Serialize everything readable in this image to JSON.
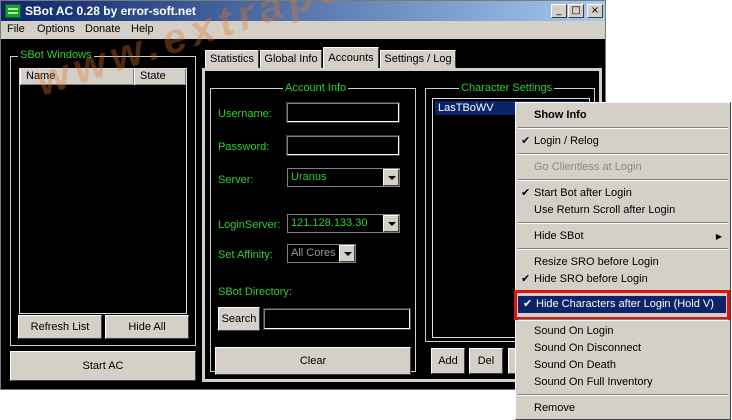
{
  "window": {
    "title": "SBot AC 0.28 by error-soft.net"
  },
  "titlebar_buttons": {
    "minimize": "_",
    "maximize": "□",
    "close": "×"
  },
  "menu": [
    "File",
    "Options",
    "Donate",
    "Help"
  ],
  "sbot_windows": {
    "label": "SBot Windows",
    "columns": [
      "Name",
      "State"
    ],
    "refresh_label": "Refresh List",
    "hide_all_label": "Hide All"
  },
  "start_label": "Start AC",
  "tabs": [
    "Statistics",
    "Global Info",
    "Accounts",
    "Settings / Log"
  ],
  "account_info": {
    "label": "Account Info",
    "username_label": "Username:",
    "password_label": "Password:",
    "server_label": "Server:",
    "server_value": "Uranus",
    "login_server_label": "LoginServer:",
    "login_server_value": "121.128.133.30",
    "affinity_label": "Set Affinity:",
    "affinity_value": "All Cores",
    "directory_label": "SBot Directory:",
    "search_label": "Search",
    "clear_label": "Clear"
  },
  "character_settings": {
    "label": "Character Settings",
    "character": "LasTBoWV",
    "add_label": "Add",
    "del_label": "Del"
  },
  "context_menu": {
    "show_info": "Show Info",
    "login_relog": "Login / Relog",
    "go_clientless": "Go Clientless at Login",
    "start_bot": "Start Bot after Login",
    "return_scroll": "Use Return Scroll after Login",
    "hide_sbot": "Hide SBot",
    "resize_sro": "Resize SRO before Login",
    "hide_sro": "Hide SRO before Login",
    "hide_chars": "Hide Characters after Login (Hold V)",
    "sound_login": "Sound On Login",
    "sound_disconnect": "Sound On Disconnect",
    "sound_death": "Sound On Death",
    "sound_inventory": "Sound On Full Inventory",
    "remove": "Remove",
    "check": "✔",
    "arrow": "▶"
  },
  "watermark": "www.extrapoo.com.ex",
  "colors": {
    "accent_green": "#2fd02f",
    "title_blue": "#0a246a",
    "highlight": "#0a246a",
    "red_box": "#e01010"
  }
}
